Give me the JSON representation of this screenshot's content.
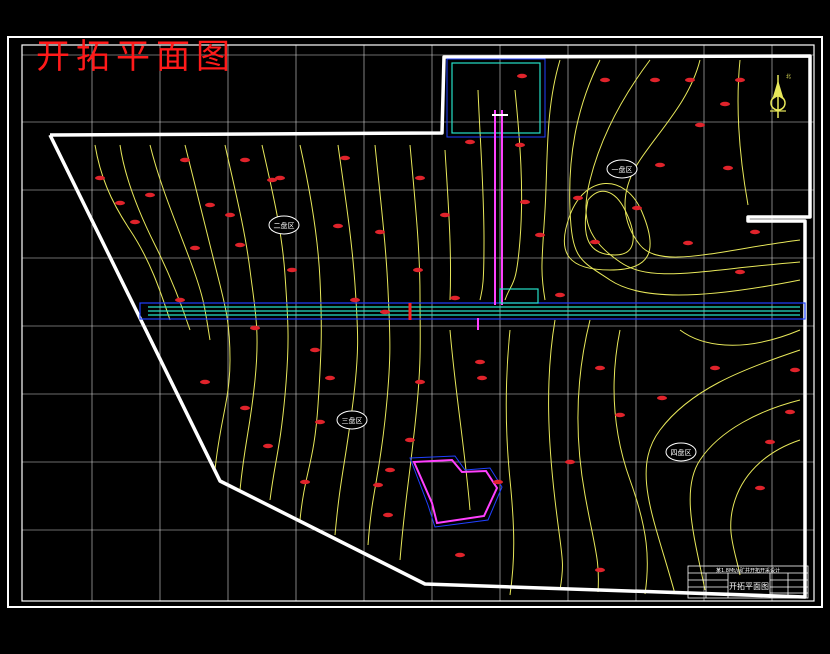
{
  "drawing": {
    "title": "开拓平面图",
    "zone_labels": [
      "二盘区",
      "一盘区",
      "三盘区",
      "四盘区"
    ]
  },
  "title_block": {
    "project": "某1.8Mt/a矿井开拓开采设计",
    "drawing_name": "开拓平面图"
  },
  "colors": {
    "background": "#000000",
    "frame": "#ffffff",
    "grid": "#ffffff",
    "contour": "#e8e85a",
    "boundary": "#ffffff",
    "roadway": "#25e0c8",
    "shaft": "#ff40ff",
    "title": "#ff1a1a",
    "borehole": "#e0232b",
    "pillar": "#2040ff"
  }
}
